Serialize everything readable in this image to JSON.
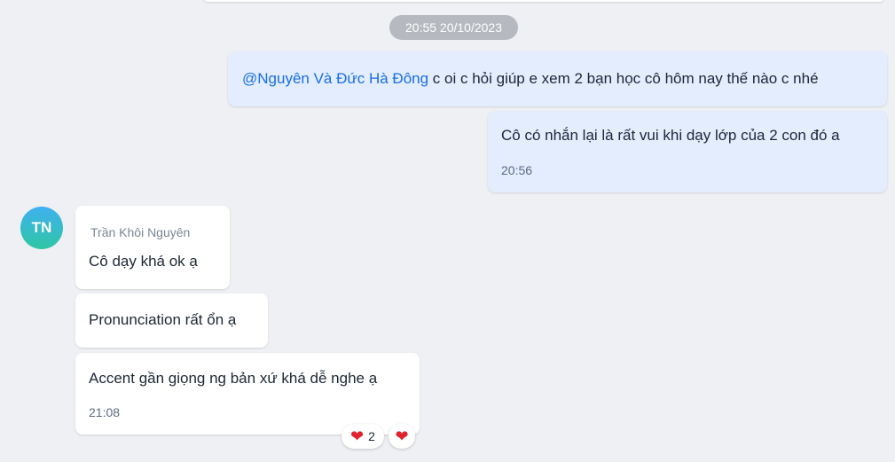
{
  "date_divider": "20:55 20/10/2023",
  "messages": [
    {
      "mention": "@Nguyên Và Đức Hà Đông",
      "text": " c oi c hỏi giúp e xem 2 bạn học cô hôm nay thế nào c nhé"
    },
    {
      "text": "Cô có nhắn lại là rất vui khi dạy lớp của 2 con đó a",
      "time": "20:56"
    },
    {
      "sender": "Trần Khôi Nguyên",
      "avatar_initials": "TN",
      "text": "Cô dạy khá ok ạ"
    },
    {
      "text": "Pronunciation rất ổn ạ"
    },
    {
      "text": "Accent gần giọng ng bản xứ khá dễ nghe ạ",
      "time": "21:08"
    }
  ],
  "reactions": [
    {
      "icon": "heart-icon",
      "glyph": "❤",
      "count": "2"
    },
    {
      "icon": "heart-icon",
      "glyph": "❤"
    }
  ],
  "colors": {
    "background": "#eef0f3",
    "outgoing_bubble": "#e3edfd",
    "incoming_bubble": "#ffffff",
    "mention": "#1a6ee6",
    "heart": "#e0232f"
  }
}
